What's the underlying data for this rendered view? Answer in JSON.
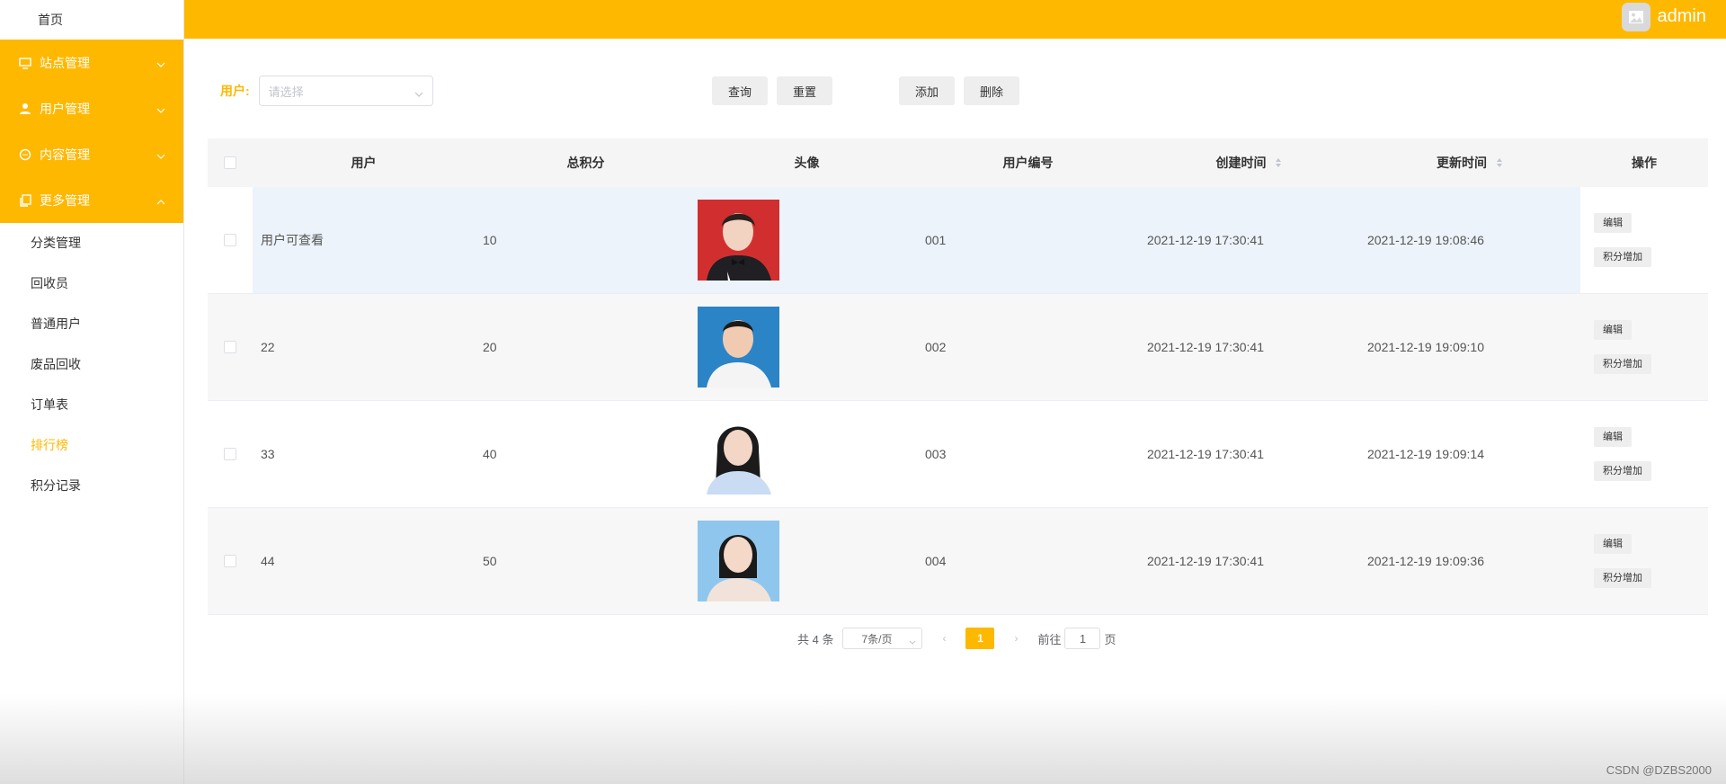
{
  "sidebar": {
    "home": "首页",
    "groups": [
      {
        "label": "站点管理",
        "icon": "monitor-icon",
        "expanded": false
      },
      {
        "label": "用户管理",
        "icon": "user-icon",
        "expanded": false
      },
      {
        "label": "内容管理",
        "icon": "chat-icon",
        "expanded": false
      },
      {
        "label": "更多管理",
        "icon": "copy-icon",
        "expanded": true
      }
    ],
    "sub_items": [
      "分类管理",
      "回收员",
      "普通用户",
      "废品回收",
      "订单表",
      "排行榜",
      "积分记录"
    ],
    "active_item": "排行榜"
  },
  "header": {
    "username": "admin",
    "avatar_icon": "image-icon",
    "accent": "#ffb800"
  },
  "search": {
    "label": "用户:",
    "placeholder": "请选择"
  },
  "buttons": {
    "query": "查询",
    "reset": "重置",
    "add": "添加",
    "delete": "删除"
  },
  "table": {
    "columns": [
      "用户",
      "总积分",
      "头像",
      "用户编号",
      "创建时间",
      "更新时间",
      "操作"
    ],
    "rows": [
      {
        "user": "用户可查看",
        "score": "10",
        "number": "001",
        "created": "2021-12-19 17:30:41",
        "updated": "2021-12-19 19:08:46"
      },
      {
        "user": "22",
        "score": "20",
        "number": "002",
        "created": "2021-12-19 17:30:41",
        "updated": "2021-12-19 19:09:10"
      },
      {
        "user": "33",
        "score": "40",
        "number": "003",
        "created": "2021-12-19 17:30:41",
        "updated": "2021-12-19 19:09:14"
      },
      {
        "user": "44",
        "score": "50",
        "number": "004",
        "created": "2021-12-19 17:30:41",
        "updated": "2021-12-19 19:09:36"
      }
    ],
    "row_actions": {
      "edit": "编辑",
      "add_points": "积分增加"
    }
  },
  "pagination": {
    "total": "共 4 条",
    "page_size": "7条/页",
    "current_page": "1",
    "goto_prefix": "前往",
    "goto_value": "1",
    "goto_suffix": "页"
  },
  "watermark": "CSDN @DZBS2000"
}
